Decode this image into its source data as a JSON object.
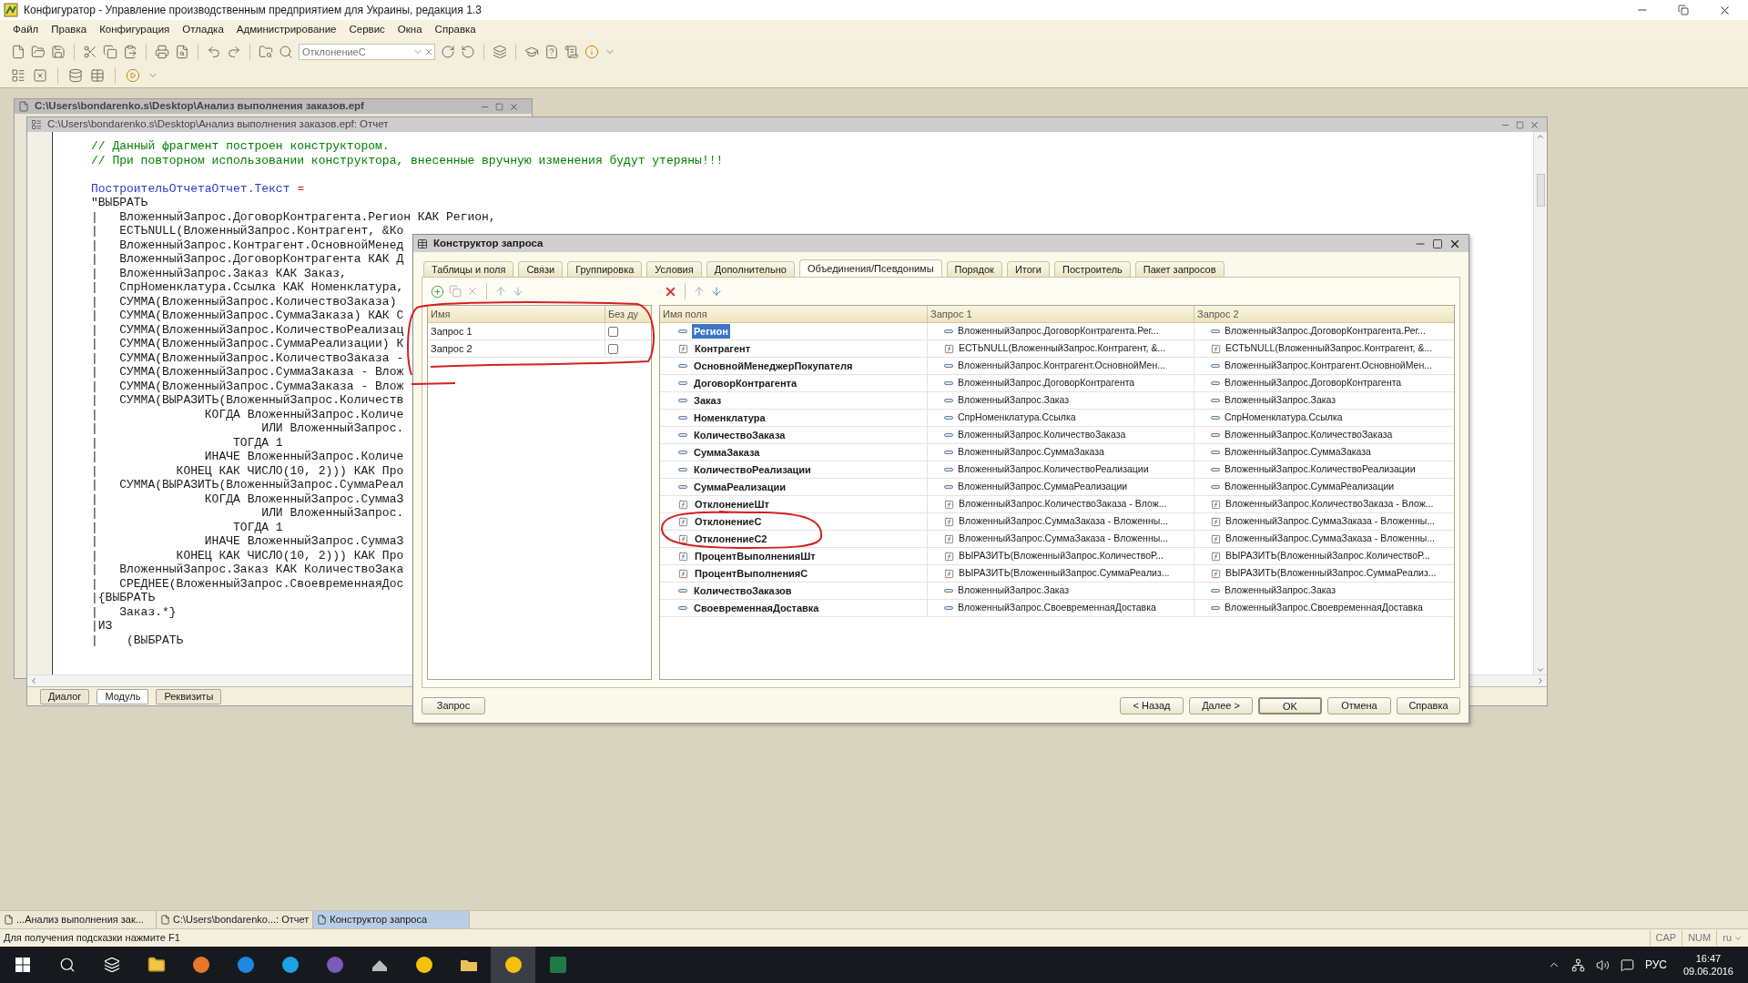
{
  "app": {
    "title": "Конфигуратор - Управление производственным предприятием для Украины, редакция 1.3"
  },
  "menu": [
    "Файл",
    "Правка",
    "Конфигурация",
    "Отладка",
    "Администрирование",
    "Сервис",
    "Окна",
    "Справка"
  ],
  "toolbar": {
    "search_value": "ОтклонениеС"
  },
  "epf_window": {
    "title": "C:\\Users\\bondarenko.s\\Desktop\\Анализ выполнения заказов.epf"
  },
  "report_window": {
    "title": "C:\\Users\\bondarenko.s\\Desktop\\Анализ выполнения заказов.epf: Отчет",
    "code_lines": [
      {
        "kind": "comment",
        "text": "// Данный фрагмент построен конструктором."
      },
      {
        "kind": "comment",
        "text": "// При повторном использовании конструктора, внесенные вручную изменения будут утеряны!!!"
      },
      {
        "kind": "blank"
      },
      {
        "kind": "assign",
        "target": "ПостроительОтчетаОтчет.Текст",
        "operator": "="
      },
      {
        "kind": "text",
        "text": "\"ВЫБРАТЬ"
      },
      {
        "kind": "text",
        "text": "|   ВложенныйЗапрос.ДоговорКонтрагента.Регион КАК Регион,"
      },
      {
        "kind": "text",
        "text": "|   ЕСТЬNULL(ВложенныйЗапрос.Контрагент, &Ко"
      },
      {
        "kind": "text",
        "text": "|   ВложенныйЗапрос.Контрагент.ОсновнойМенед"
      },
      {
        "kind": "text",
        "text": "|   ВложенныйЗапрос.ДоговорКонтрагента КАК Д"
      },
      {
        "kind": "text",
        "text": "|   ВложенныйЗапрос.Заказ КАК Заказ,"
      },
      {
        "kind": "text",
        "text": "|   СпрНоменклатура.Ссылка КАК Номенклатура,"
      },
      {
        "kind": "text",
        "text": "|   СУММА(ВложенныйЗапрос.КоличествоЗаказа)"
      },
      {
        "kind": "text",
        "text": "|   СУММА(ВложенныйЗапрос.СуммаЗаказа) КАК С"
      },
      {
        "kind": "text",
        "text": "|   СУММА(ВложенныйЗапрос.КоличествоРеализац"
      },
      {
        "kind": "text",
        "text": "|   СУММА(ВложенныйЗапрос.СуммаРеализации) К"
      },
      {
        "kind": "text",
        "text": "|   СУММА(ВложенныйЗапрос.КоличествоЗаказа -"
      },
      {
        "kind": "text",
        "text": "|   СУММА(ВложенныйЗапрос.СуммаЗаказа - Влож"
      },
      {
        "kind": "text",
        "text": "|   СУММА(ВложенныйЗапрос.СуммаЗаказа - Влож"
      },
      {
        "kind": "text",
        "text": "|   СУММА(ВЫРАЗИТЬ(ВложенныйЗапрос.Количеств"
      },
      {
        "kind": "text",
        "text": "|               КОГДА ВложенныйЗапрос.Количе"
      },
      {
        "kind": "text",
        "text": "|                       ИЛИ ВложенныйЗапрос."
      },
      {
        "kind": "text",
        "text": "|                   ТОГДА 1"
      },
      {
        "kind": "text",
        "text": "|               ИНАЧЕ ВложенныйЗапрос.Количе"
      },
      {
        "kind": "text",
        "text": "|           КОНЕЦ КАК ЧИСЛО(10, 2))) КАК Про"
      },
      {
        "kind": "text",
        "text": "|   СУММА(ВЫРАЗИТЬ(ВложенныйЗапрос.СуммаРеал"
      },
      {
        "kind": "text",
        "text": "|               КОГДА ВложенныйЗапрос.СуммаЗ"
      },
      {
        "kind": "text",
        "text": "|                       ИЛИ ВложенныйЗапрос."
      },
      {
        "kind": "text",
        "text": "|                   ТОГДА 1"
      },
      {
        "kind": "text",
        "text": "|               ИНАЧЕ ВложенныйЗапрос.СуммаЗ"
      },
      {
        "kind": "text",
        "text": "|           КОНЕЦ КАК ЧИСЛО(10, 2))) КАК Про"
      },
      {
        "kind": "text",
        "text": "|   ВложенныйЗапрос.Заказ КАК КоличествоЗака"
      },
      {
        "kind": "text",
        "text": "|   СРЕДНЕЕ(ВложенныйЗапрос.СвоевременнаяДос"
      },
      {
        "kind": "text",
        "text": "|{ВЫБРАТЬ"
      },
      {
        "kind": "text",
        "text": "|   Заказ.*}"
      },
      {
        "kind": "text",
        "text": "|ИЗ"
      },
      {
        "kind": "text",
        "text": "|    (ВЫБРАТЬ"
      }
    ],
    "tabs": [
      {
        "label": "Диалог",
        "selected": false
      },
      {
        "label": "Модуль",
        "selected": true
      },
      {
        "label": "Реквизиты",
        "selected": false
      }
    ]
  },
  "dialog": {
    "title": "Конструктор запроса",
    "tabs": [
      {
        "label": "Таблицы и поля",
        "selected": false
      },
      {
        "label": "Связи",
        "selected": false
      },
      {
        "label": "Группировка",
        "selected": false
      },
      {
        "label": "Условия",
        "selected": false
      },
      {
        "label": "Дополнительно",
        "selected": false
      },
      {
        "label": "Объединения/Псевдонимы",
        "selected": true
      },
      {
        "label": "Порядок",
        "selected": false
      },
      {
        "label": "Итоги",
        "selected": false
      },
      {
        "label": "Построитель",
        "selected": false
      },
      {
        "label": "Пакет запросов",
        "selected": false
      }
    ],
    "queries": {
      "columns": [
        "Имя",
        "Без ду"
      ],
      "rows": [
        {
          "name": "Запрос 1",
          "checked": false
        },
        {
          "name": "Запрос 2",
          "checked": false
        }
      ]
    },
    "fields": {
      "columns": [
        "Имя поля",
        "Запрос 1",
        "Запрос 2"
      ],
      "rows": [
        {
          "kind": "field",
          "name": "Регион",
          "selected": true,
          "cells": [
            "ВложенныйЗапрос.ДоговорКонтрагента.Рег...",
            "ВложенныйЗапрос.ДоговорКонтрагента.Рег..."
          ]
        },
        {
          "kind": "expression",
          "name": "Контрагент",
          "selected": false,
          "cells": [
            "ЕСТЬNULL(ВложенныйЗапрос.Контрагент, &...",
            "ЕСТЬNULL(ВложенныйЗапрос.Контрагент, &..."
          ]
        },
        {
          "kind": "field",
          "name": "ОсновнойМенеджерПокупателя",
          "selected": false,
          "cells": [
            "ВложенныйЗапрос.Контрагент.ОсновнойМен...",
            "ВложенныйЗапрос.Контрагент.ОсновнойМен..."
          ]
        },
        {
          "kind": "field",
          "name": "ДоговорКонтрагента",
          "selected": false,
          "cells": [
            "ВложенныйЗапрос.ДоговорКонтрагента",
            "ВложенныйЗапрос.ДоговорКонтрагента"
          ]
        },
        {
          "kind": "field",
          "name": "Заказ",
          "selected": false,
          "cells": [
            "ВложенныйЗапрос.Заказ",
            "ВложенныйЗапрос.Заказ"
          ]
        },
        {
          "kind": "field",
          "name": "Номенклатура",
          "selected": false,
          "cells": [
            "СпрНоменклатура.Ссылка",
            "СпрНоменклатура.Ссылка"
          ]
        },
        {
          "kind": "field",
          "name": "КоличествоЗаказа",
          "selected": false,
          "cells": [
            "ВложенныйЗапрос.КоличествоЗаказа",
            "ВложенныйЗапрос.КоличествоЗаказа"
          ]
        },
        {
          "kind": "field",
          "name": "СуммаЗаказа",
          "selected": false,
          "cells": [
            "ВложенныйЗапрос.СуммаЗаказа",
            "ВложенныйЗапрос.СуммаЗаказа"
          ]
        },
        {
          "kind": "field",
          "name": "КоличествоРеализации",
          "selected": false,
          "cells": [
            "ВложенныйЗапрос.КоличествоРеализации",
            "ВложенныйЗапрос.КоличествоРеализации"
          ]
        },
        {
          "kind": "field",
          "name": "СуммаРеализации",
          "selected": false,
          "cells": [
            "ВложенныйЗапрос.СуммаРеализации",
            "ВложенныйЗапрос.СуммаРеализации"
          ]
        },
        {
          "kind": "expression",
          "name": "ОтклонениеШт",
          "selected": false,
          "cells": [
            "ВложенныйЗапрос.КоличествоЗаказа - Влож...",
            "ВложенныйЗапрос.КоличествоЗаказа - Влож..."
          ]
        },
        {
          "kind": "expression",
          "name": "ОтклонениеС",
          "selected": false,
          "cells": [
            "ВложенныйЗапрос.СуммаЗаказа - Вложенны...",
            "ВложенныйЗапрос.СуммаЗаказа - Вложенны..."
          ]
        },
        {
          "kind": "expression",
          "name": "ОтклонениеС2",
          "selected": false,
          "cells": [
            "ВложенныйЗапрос.СуммаЗаказа - Вложенны...",
            "ВложенныйЗапрос.СуммаЗаказа - Вложенны..."
          ]
        },
        {
          "kind": "expression",
          "name": "ПроцентВыполненияШт",
          "selected": false,
          "cells": [
            "ВЫРАЗИТЬ(ВложенныйЗапрос.КоличествоР...",
            "ВЫРАЗИТЬ(ВложенныйЗапрос.КоличествоР..."
          ]
        },
        {
          "kind": "expression",
          "name": "ПроцентВыполненияС",
          "selected": false,
          "cells": [
            "ВЫРАЗИТЬ(ВложенныйЗапрос.СуммаРеализ...",
            "ВЫРАЗИТЬ(ВложенныйЗапрос.СуммаРеализ..."
          ]
        },
        {
          "kind": "field",
          "name": "КоличествоЗаказов",
          "selected": false,
          "cells": [
            "ВложенныйЗапрос.Заказ",
            "ВложенныйЗапрос.Заказ"
          ]
        },
        {
          "kind": "field",
          "name": "СвоевременнаяДоставка",
          "selected": false,
          "cells": [
            "ВложенныйЗапрос.СвоевременнаяДоставка",
            "ВложенныйЗапрос.СвоевременнаяДоставка"
          ]
        }
      ]
    },
    "query_button": "Запрос",
    "buttons": [
      "< Назад",
      "Далее >",
      "OK",
      "Отмена",
      "Справка"
    ]
  },
  "mdi_tabs": [
    {
      "label": "...Анализ выполнения зак...",
      "selected": false
    },
    {
      "label": "C:\\Users\\bondarenko...: Отчет",
      "selected": false
    },
    {
      "label": "Конструктор запроса",
      "selected": true
    }
  ],
  "status_bar": {
    "hint": "Для получения подсказки нажмите F1",
    "indicators": [
      "CAP",
      "NUM",
      "ru"
    ]
  },
  "taskbar": {
    "language": "РУС",
    "time": "16:47",
    "date": "09.06.2016"
  }
}
